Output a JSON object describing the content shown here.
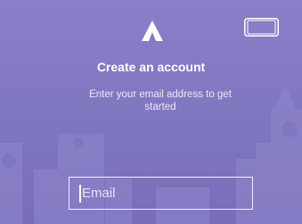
{
  "screen": {
    "title": "Create an account",
    "subtitle": "Enter your email address to get started"
  },
  "email_field": {
    "placeholder": "Email",
    "value": ""
  },
  "icons": {
    "logo": "triangle-logo-icon",
    "top_right": "device-landscape-icon"
  },
  "colors": {
    "background": "#8179c2",
    "text": "#ffffff"
  }
}
